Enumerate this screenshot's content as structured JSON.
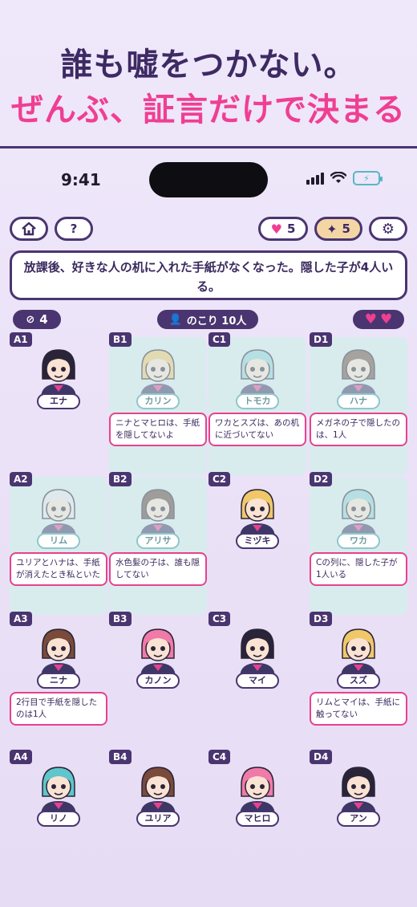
{
  "headline": {
    "line1": "誰も嘘をつかない。",
    "line2": "ぜんぶ、証言だけで決まる"
  },
  "status_bar": {
    "time": "9:41"
  },
  "toolbar": {
    "hearts": "5",
    "hints": "5"
  },
  "question": "放課後、好きな人の机に入れた手紙がなくなった。隠した子が4人いる。",
  "info": {
    "mistakes": "4",
    "remaining": "のこり 10人"
  },
  "colors": {
    "accent": "#ef3f93",
    "dark": "#4a3570",
    "reveal_bg": "#d8ecee"
  },
  "cells": [
    {
      "id": "A1",
      "name": "エナ",
      "revealed": false,
      "hair": "#2a2438",
      "statement": ""
    },
    {
      "id": "B1",
      "name": "カリン",
      "revealed": true,
      "hair": "#f0c86a",
      "statement": "ニナとマヒロは、手紙を隠してないよ"
    },
    {
      "id": "C1",
      "name": "トモカ",
      "revealed": true,
      "hair": "#8fd0d6",
      "statement": "ワカとスズは、あの机に近づいてない"
    },
    {
      "id": "D1",
      "name": "ハナ",
      "revealed": true,
      "hair": "#6b4a3e",
      "statement": "メガネの子で隠したのは、1人"
    },
    {
      "id": "A2",
      "name": "リム",
      "revealed": true,
      "hair": "#e7e7ee",
      "statement": "ユリアとハナは、手紙が消えたとき私といた"
    },
    {
      "id": "B2",
      "name": "アリサ",
      "revealed": true,
      "hair": "#5a3e38",
      "statement": "水色髪の子は、誰も隠してない"
    },
    {
      "id": "C2",
      "name": "ミヅキ",
      "revealed": false,
      "hair": "#f0c86a",
      "statement": ""
    },
    {
      "id": "D2",
      "name": "ワカ",
      "revealed": true,
      "hair": "#8fd0d6",
      "statement": "Cの列に、隠した子が1人いる"
    },
    {
      "id": "A3",
      "name": "ニナ",
      "revealed": false,
      "hair": "#7a4a3a",
      "statement": "2行目で手紙を隠したのは1人"
    },
    {
      "id": "B3",
      "name": "カノン",
      "revealed": false,
      "hair": "#f07aa8",
      "statement": ""
    },
    {
      "id": "C3",
      "name": "マイ",
      "revealed": false,
      "hair": "#2a2438",
      "statement": ""
    },
    {
      "id": "D3",
      "name": "スズ",
      "revealed": false,
      "hair": "#f0c86a",
      "statement": "リムとマイは、手紙に触ってない"
    },
    {
      "id": "A4",
      "name": "リノ",
      "revealed": false,
      "hair": "#5fc6cc",
      "statement": ""
    },
    {
      "id": "B4",
      "name": "ユリア",
      "revealed": false,
      "hair": "#7a4a3a",
      "statement": ""
    },
    {
      "id": "C4",
      "name": "マヒロ",
      "revealed": false,
      "hair": "#f07aa8",
      "statement": ""
    },
    {
      "id": "D4",
      "name": "アン",
      "revealed": false,
      "hair": "#2a2438",
      "statement": ""
    }
  ]
}
